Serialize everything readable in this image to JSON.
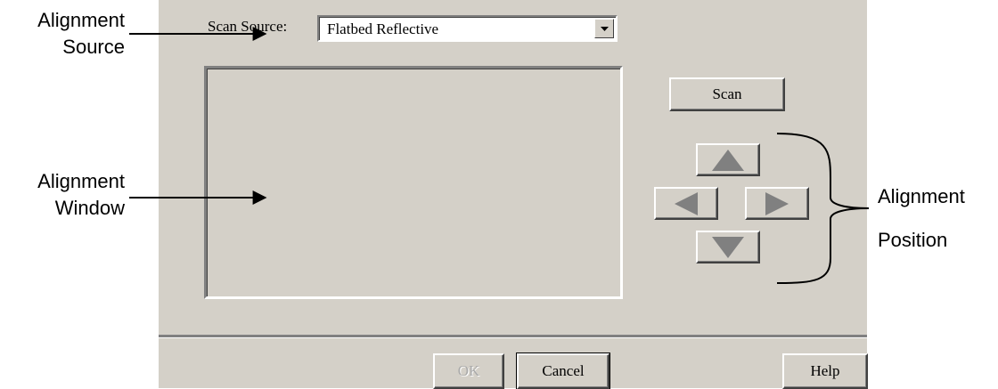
{
  "annotations": {
    "alignment_source": [
      "Alignment",
      "Source"
    ],
    "alignment_window": [
      "Alignment",
      "Window"
    ],
    "alignment_position": [
      "Alignment",
      "Position"
    ]
  },
  "dialog": {
    "scan_source_label": "Scan Source:",
    "scan_source_value": "Flatbed Reflective",
    "scan_button": "Scan",
    "ok_button": "OK",
    "cancel_button": "Cancel",
    "help_button": "Help"
  },
  "icons": {
    "up": "triangle-up-icon",
    "left": "triangle-left-icon",
    "right": "triangle-right-icon",
    "down": "triangle-down-icon",
    "dropdown": "chevron-down-icon"
  },
  "colors": {
    "dialog_bg": "#d4d0c8",
    "arrow_fill": "#808080"
  }
}
